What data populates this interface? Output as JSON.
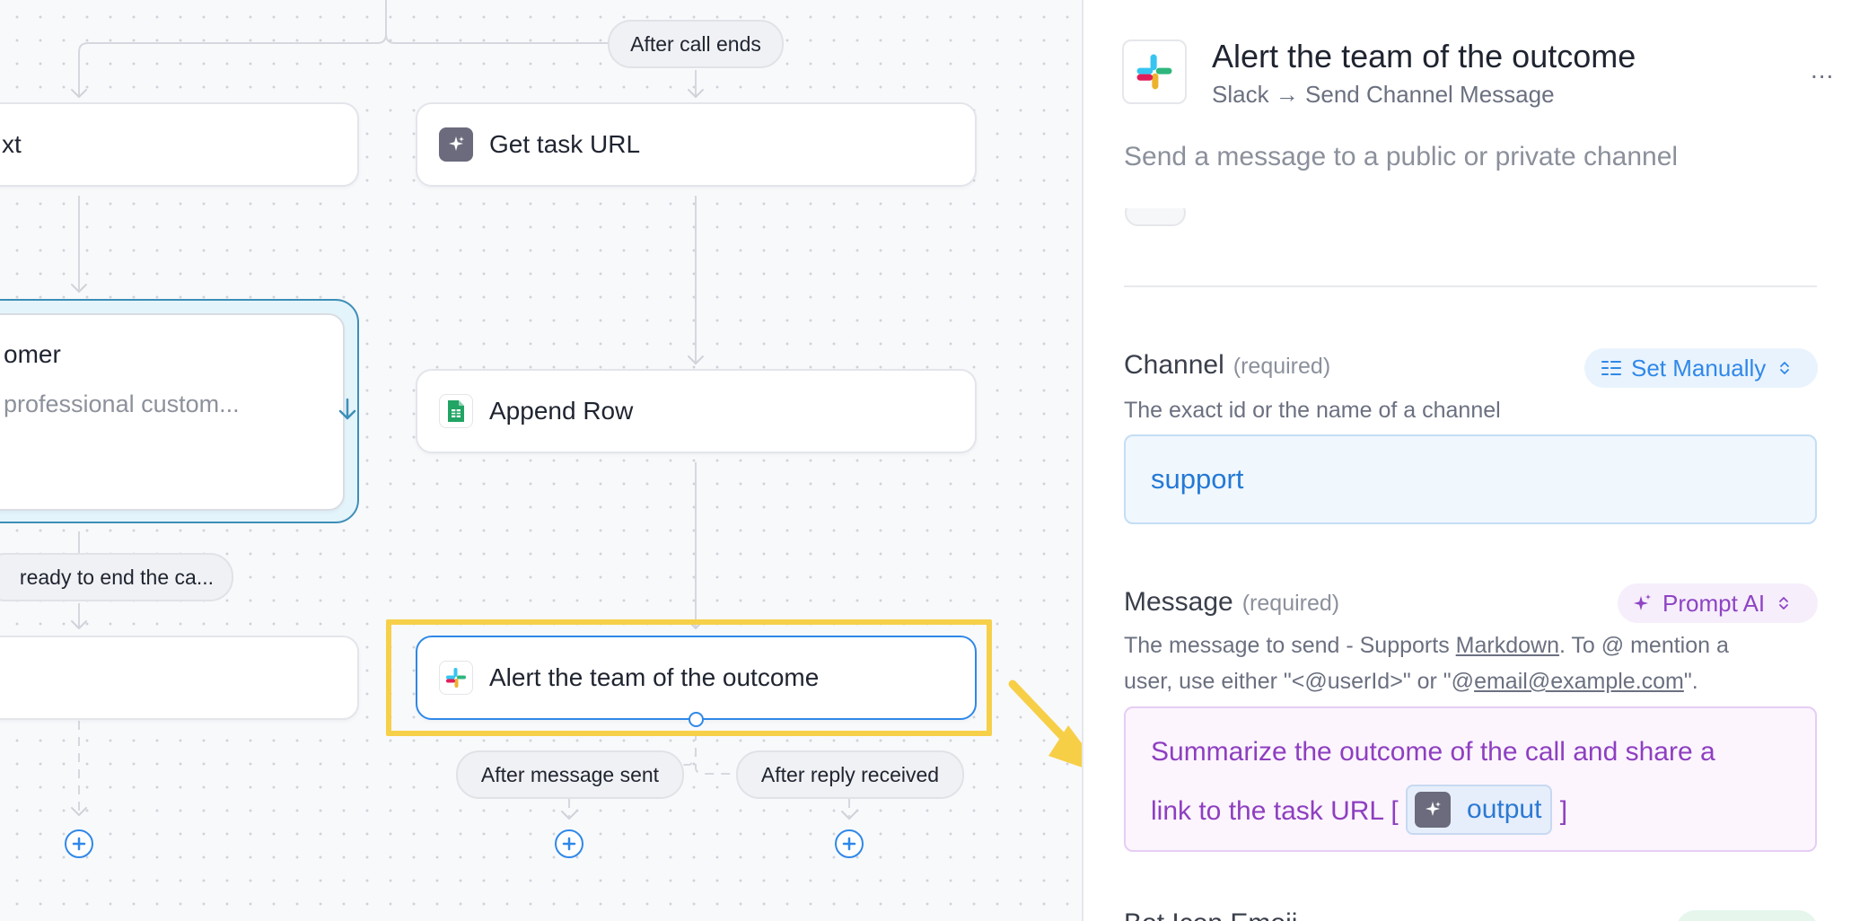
{
  "canvas": {
    "pills": {
      "after_call_ends": "After call ends",
      "ready_to_end": "ready to end the ca...",
      "after_message_sent": "After message sent",
      "after_reply_received": "After reply received"
    },
    "nodes": {
      "left_top_partial": "xt",
      "get_task_url": "Get task URL",
      "customer_title_partial": "omer",
      "customer_desc_partial": "professional custom...",
      "append_row": "Append Row",
      "alert_team": "Alert the team of the outcome"
    },
    "icons": {
      "ai": "sparkle-icon",
      "sheets": "google-sheets-icon",
      "slack": "slack-icon",
      "add": "plus-circle-icon"
    },
    "highlight_color": "#f7d04a",
    "selected_color": "#2f88e8"
  },
  "panel": {
    "title": "Alert the team of the outcome",
    "subtitle": "Slack → Send Channel Message",
    "description": "Send a message to a public or private channel",
    "more_menu": "...",
    "channel": {
      "label": "Channel",
      "required": "(required)",
      "mode": "Set Manually",
      "help": "The exact id or the name of a channel",
      "value": "support"
    },
    "message": {
      "label": "Message",
      "required": "(required)",
      "mode": "Prompt AI",
      "help_1": "The message to send - Supports ",
      "help_markdown": "Markdown",
      "help_2": ". To @ mention a",
      "help_3": "user, use either \"<@userId>\" or \"@",
      "help_email": "email@example.com",
      "help_4": "\".",
      "value_line1": "Summarize the outcome of the call and share a",
      "value_line2": "link to the task URL [",
      "token": "output",
      "value_close": "]"
    },
    "next_field_partial": "Bot Icon Emoji"
  }
}
